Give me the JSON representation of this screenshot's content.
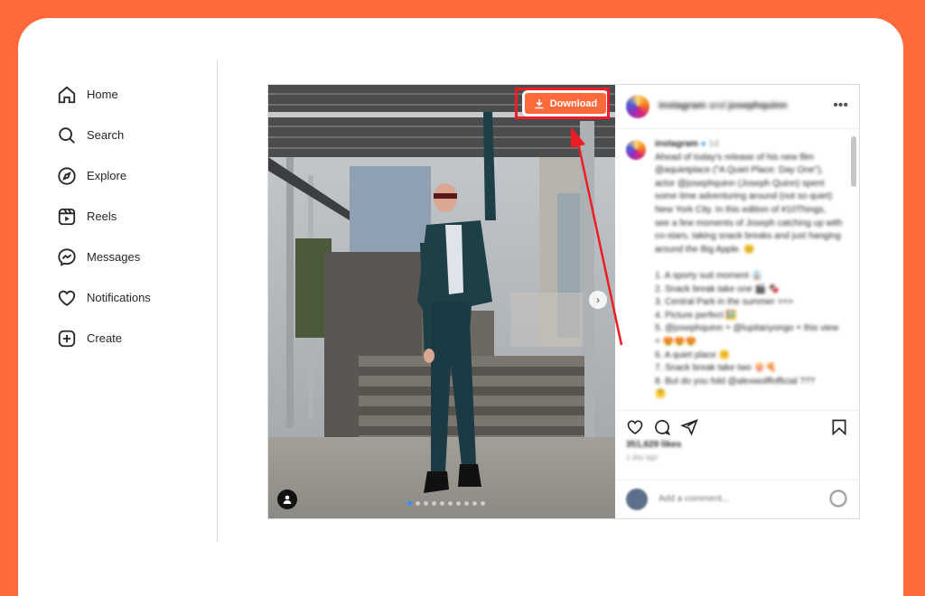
{
  "sidebar": {
    "items": [
      {
        "label": "Home",
        "icon": "home-icon"
      },
      {
        "label": "Search",
        "icon": "search-icon"
      },
      {
        "label": "Explore",
        "icon": "compass-icon"
      },
      {
        "label": "Reels",
        "icon": "reels-icon"
      },
      {
        "label": "Messages",
        "icon": "messenger-icon"
      },
      {
        "label": "Notifications",
        "icon": "heart-icon"
      },
      {
        "label": "Create",
        "icon": "plus-square-icon"
      }
    ]
  },
  "post": {
    "header": {
      "account": "instagram",
      "joiner": "and",
      "collaborator": "josephquinn"
    },
    "download_label": "Download",
    "carousel": {
      "total": 10,
      "current": 1
    },
    "caption": {
      "user": "instagram",
      "age": "1d",
      "text": "Ahead of today's release of his new film @aquietplace (\"A Quiet Place: Day One\"), actor @josephquinn (Joseph Quinn) spent some time adventuring around (not so quiet) New York City. In this edition of #10Things, see a few moments of Joseph catching up with co-stars, taking snack breaks and just hanging around the Big Apple. 😊\n\n1. A sporty suit moment 👔\n2. Snack break take one 🎬 🍫\n3. Central Park in the summer >>>\n4. Picture perfect 🖼️\n5. @josephquinn + @lupitanyongo + this view = 😍😍😍\n6. A quiet place 🤫\n7. Snack break take two 🍿🍕\n8. But do you fold @alexwolffofficial ???\n🤔"
    },
    "likes": "351,629 likes",
    "time": "1 day ago",
    "comment_placeholder": "Add a comment..."
  },
  "colors": {
    "page_background": "#ff6a3d",
    "download_button": "#ff6a3d",
    "highlight": "#ee1c24"
  }
}
